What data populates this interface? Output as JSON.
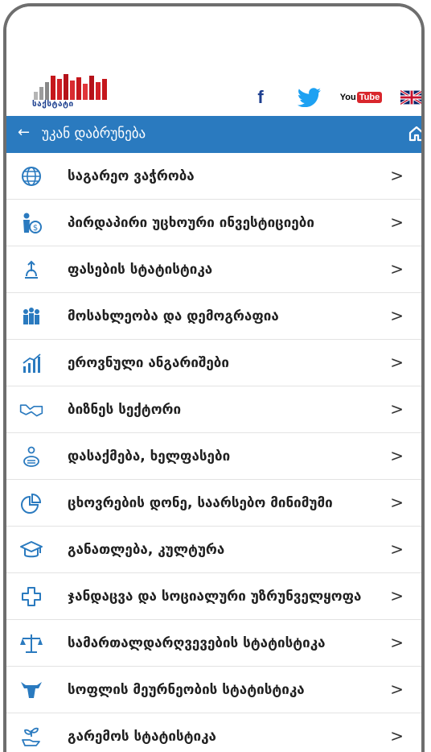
{
  "header": {
    "logo_text": "საქსტატი",
    "social": {
      "facebook": "f",
      "youtube_you": "You",
      "youtube_tube": "Tube"
    }
  },
  "nav": {
    "back_arrow": "←",
    "back_label": "უკან დაბრუნება"
  },
  "colors": {
    "nav_bar": "#2a7abf",
    "icon_blue": "#2a7abf",
    "youtube_red": "#d9262c",
    "facebook_blue": "#1d3e8f",
    "twitter_blue": "#1da1f2"
  },
  "items": [
    {
      "label": "საგარეო ვაჭრობა",
      "icon": "globe-dollar-icon",
      "chevron": ">"
    },
    {
      "label": "პირდაპირი უცხოური ინვესტიციები",
      "icon": "investor-money-icon",
      "chevron": ">"
    },
    {
      "label": "ფასების სტატისტიკა",
      "icon": "price-tag-icon",
      "chevron": ">"
    },
    {
      "label": "მოსახლეობა და დემოგრაფია",
      "icon": "population-icon",
      "chevron": ">"
    },
    {
      "label": "ეროვნული ანგარიშები",
      "icon": "growth-chart-icon",
      "chevron": ">"
    },
    {
      "label": "ბიზნეს სექტორი",
      "icon": "handshake-icon",
      "chevron": ">"
    },
    {
      "label": "დასაქმება, ხელფასები",
      "icon": "employment-icon",
      "chevron": ">"
    },
    {
      "label": "ცხოვრების დონე, საარსებო მინიმუმი",
      "icon": "pie-chart-icon",
      "chevron": ">"
    },
    {
      "label": "განათლება, კულტურა",
      "icon": "graduation-cap-icon",
      "chevron": ">"
    },
    {
      "label": "ჯანდაცვა და სოციალური უზრუნველყოფა",
      "icon": "medical-cross-icon",
      "chevron": ">"
    },
    {
      "label": "სამართალდარღვევების სტატისტიკა",
      "icon": "scales-icon",
      "chevron": ">"
    },
    {
      "label": "სოფლის მეურნეობის სტატისტიკა",
      "icon": "cow-icon",
      "chevron": ">"
    },
    {
      "label": "გარემოს სტატისტიკა",
      "icon": "plant-hand-icon",
      "chevron": ">"
    }
  ]
}
